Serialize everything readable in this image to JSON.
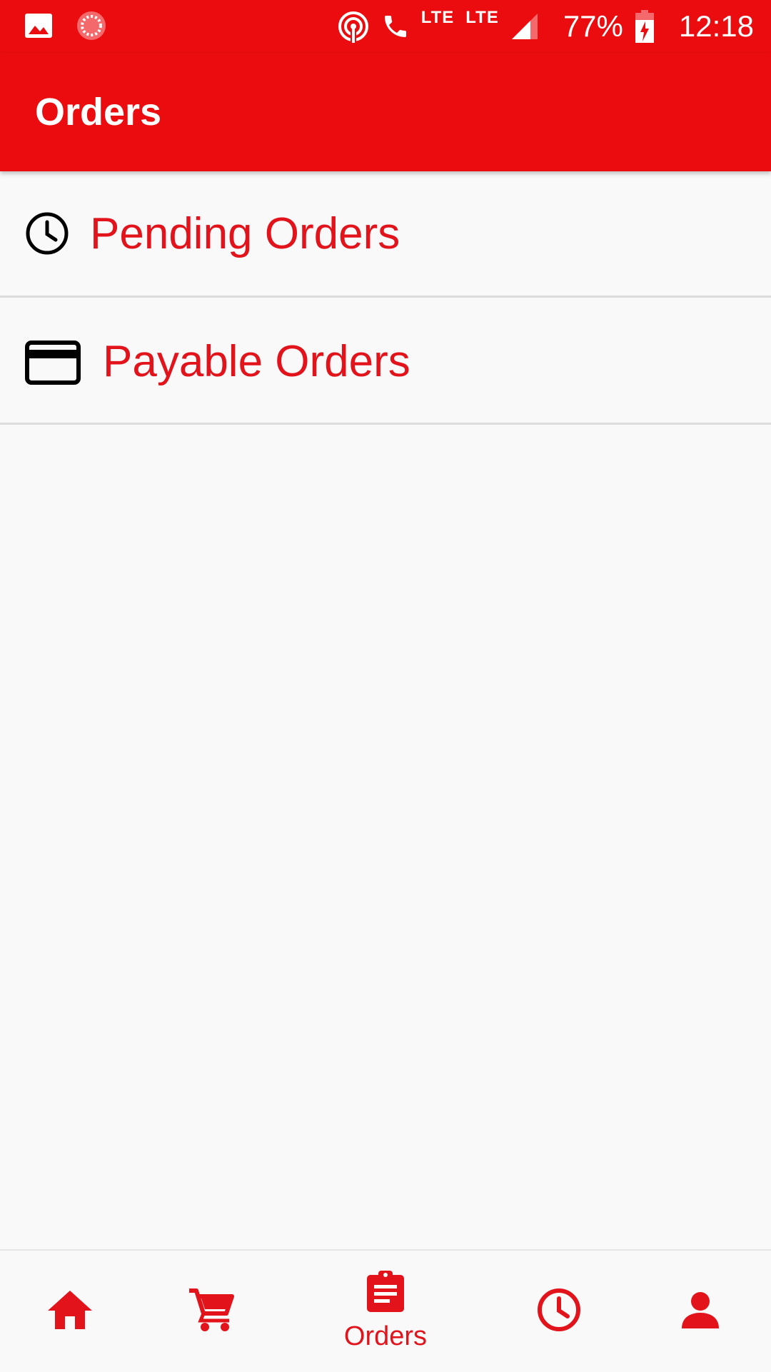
{
  "status_bar": {
    "lte1": "LTE",
    "lte2": "LTE",
    "battery_percent": "77%",
    "time": "12:18"
  },
  "app_bar": {
    "title": "Orders"
  },
  "list": {
    "items": [
      {
        "label": "Pending Orders",
        "icon": "clock-icon"
      },
      {
        "label": "Payable Orders",
        "icon": "credit-card-icon"
      }
    ]
  },
  "bottom_nav": {
    "items": [
      {
        "icon": "home-icon"
      },
      {
        "icon": "cart-icon"
      },
      {
        "icon": "assignment-icon",
        "label": "Orders",
        "active": true
      },
      {
        "icon": "history-clock-icon"
      },
      {
        "icon": "person-icon"
      }
    ]
  },
  "colors": {
    "primary": "#EB0C10",
    "accent_text": "#E2131B",
    "background": "#F9F9FA",
    "divider": "#DCDCDC"
  }
}
